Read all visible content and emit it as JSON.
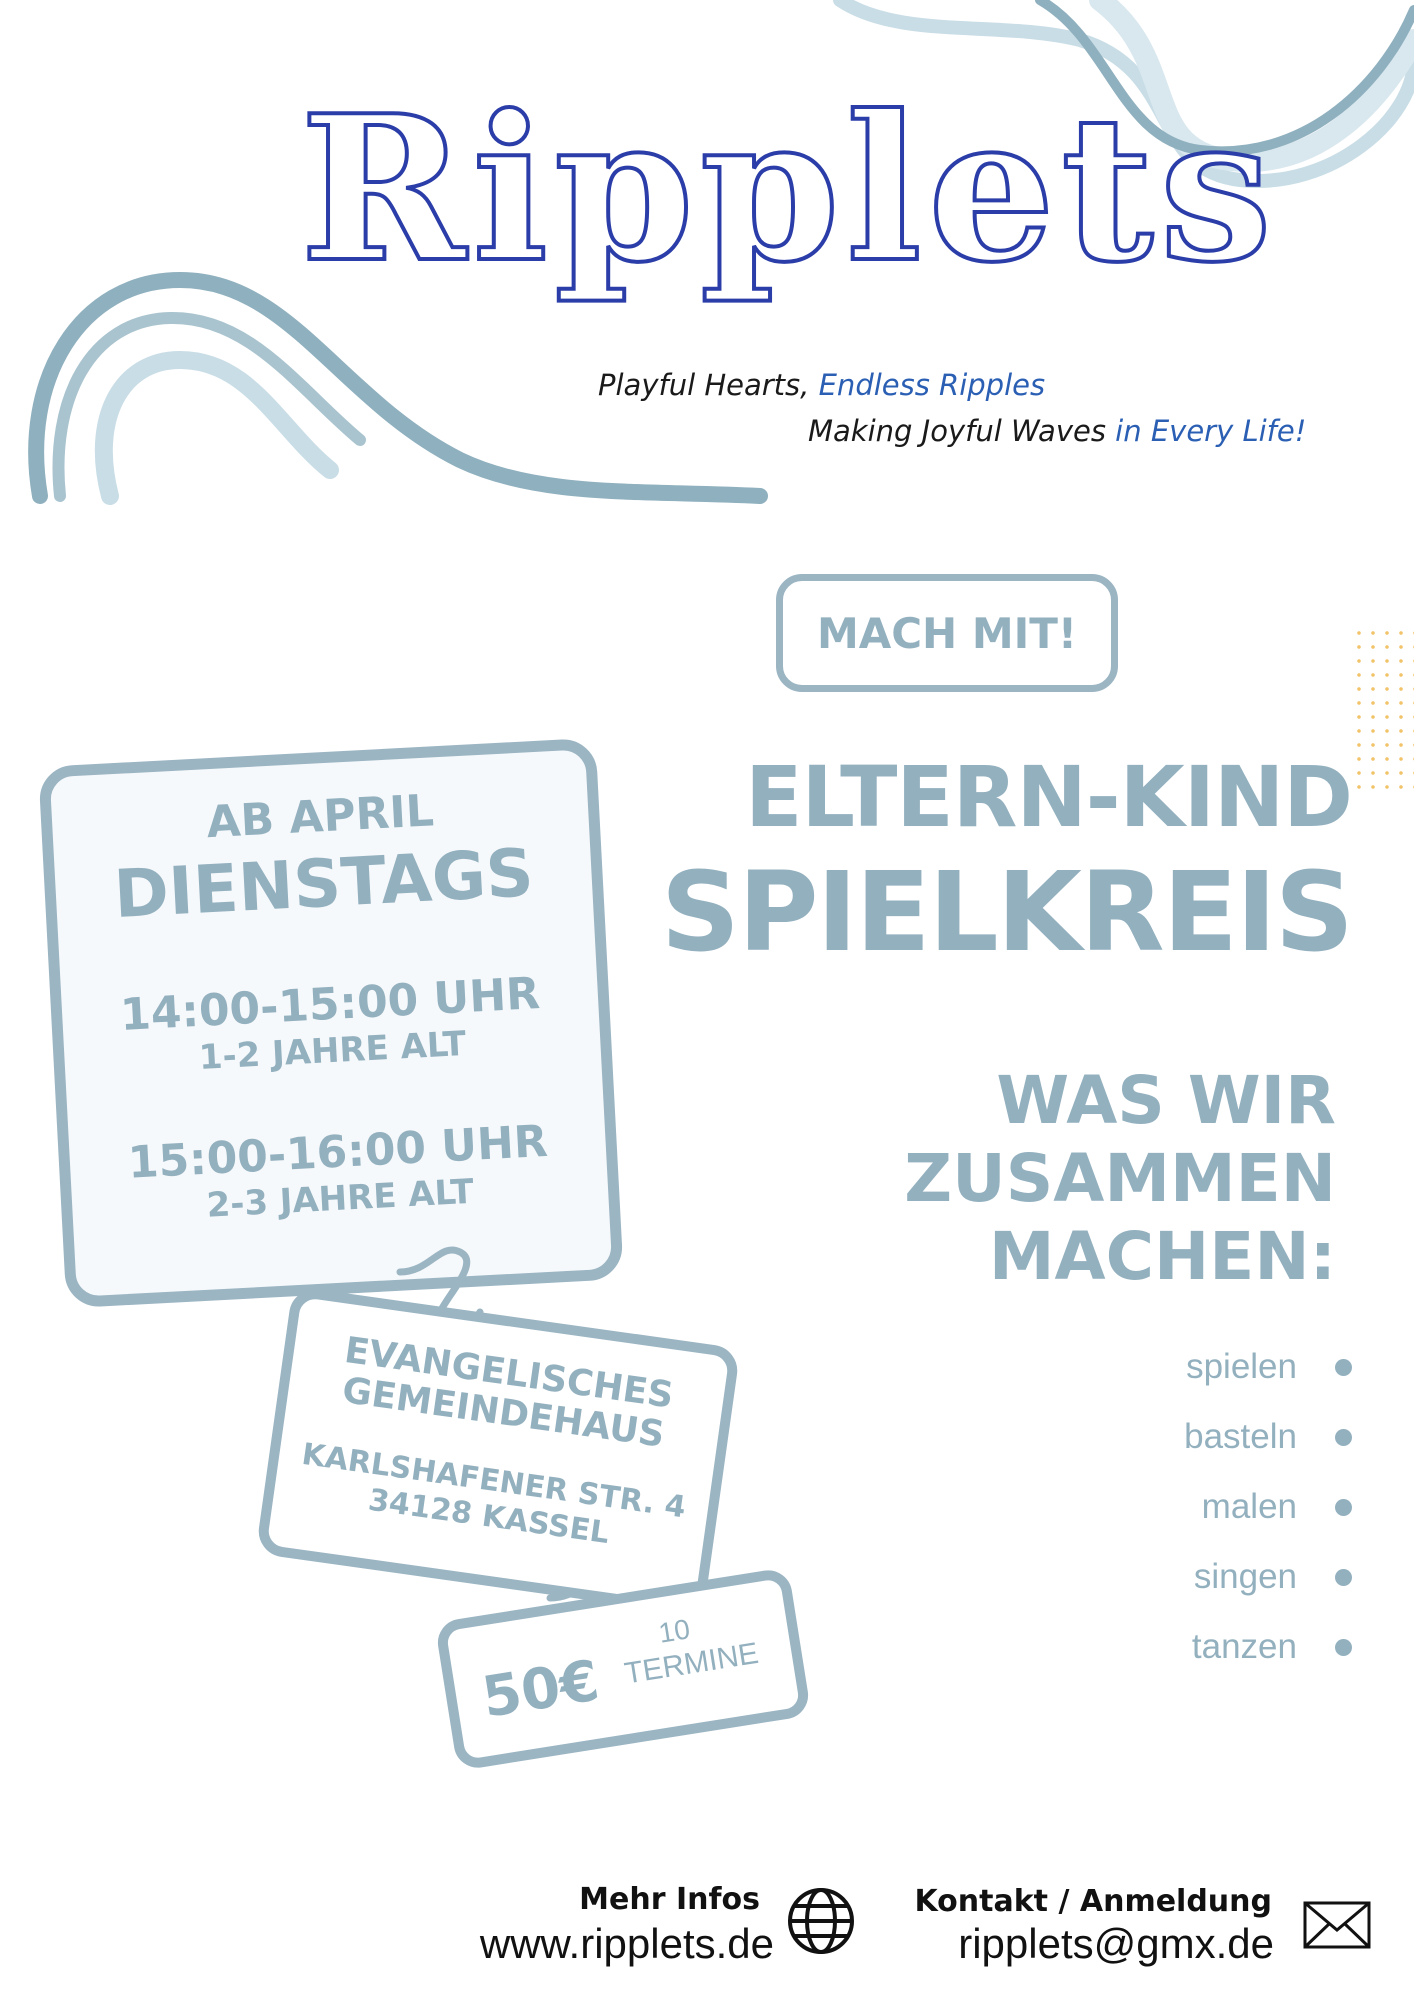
{
  "brand": {
    "logo_text": "Ripplets",
    "tagline1_a": "Playful Hearts, ",
    "tagline1_b": "Endless Ripples",
    "tagline2_a": "Making Joyful Waves ",
    "tagline2_b": "in Every Life!"
  },
  "cta": "MACH MIT!",
  "title": {
    "line1": "ELTERN-KIND",
    "line2": "SPIELKREIS"
  },
  "schedule": {
    "start": "AB APRIL",
    "day": "DIENSTAGS",
    "slot1_time": "14:00-15:00 UHR",
    "slot1_age": "1-2 JAHRE ALT",
    "slot2_time": "15:00-16:00 UHR",
    "slot2_age": "2-3 JAHRE ALT"
  },
  "location": {
    "name1": "EVANGELISCHES",
    "name2": "GEMEINDEHAUS",
    "street": "KARLSHAFENER STR. 4",
    "city": "34128 KASSEL"
  },
  "price": {
    "amount": "50€",
    "count": "10",
    "unit": "TERMINE"
  },
  "activities": {
    "heading1": "WAS WIR",
    "heading2": "ZUSAMMEN",
    "heading3": "MACHEN:",
    "items": [
      "spielen",
      "basteln",
      "malen",
      "singen",
      "tanzen"
    ]
  },
  "contact": {
    "info_label": "Mehr Infos",
    "website": "www.ripplets.de",
    "contact_label": "Kontakt / Anmeldung",
    "email": "ripplets@gmx.de"
  },
  "colors": {
    "accent": "#93b0bf",
    "logo": "#2b3da8",
    "tagline_blue": "#2a5fb4"
  },
  "icons": {
    "web": "globe-icon",
    "mail": "envelope-icon"
  }
}
